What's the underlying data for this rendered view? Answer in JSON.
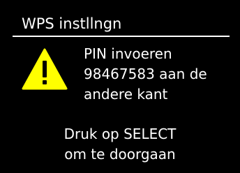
{
  "header": {
    "title": "WPS instllngn"
  },
  "warning": {
    "icon": "warning-icon",
    "color": "#ffff00",
    "lines": [
      "PIN invoeren",
      "98467583 aan de",
      "andere kant"
    ]
  },
  "prompt": {
    "lines": [
      "Druk op SELECT",
      "om te doorgaan"
    ]
  }
}
